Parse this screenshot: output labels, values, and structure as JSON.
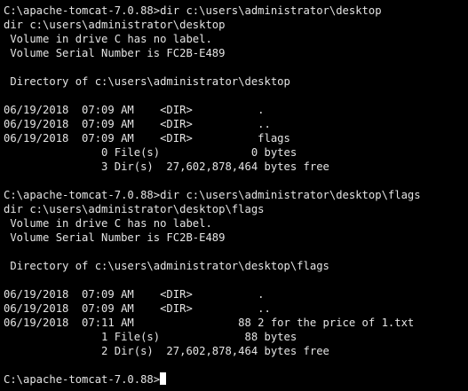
{
  "colors": {
    "background": "#000000",
    "foreground": "#e4e4e4",
    "cursor": "#ffffff"
  },
  "terminal": {
    "lines": [
      "C:\\apache-tomcat-7.0.88>dir c:\\users\\administrator\\desktop",
      "dir c:\\users\\administrator\\desktop",
      " Volume in drive C has no label.",
      " Volume Serial Number is FC2B-E489",
      "",
      " Directory of c:\\users\\administrator\\desktop",
      "",
      "06/19/2018  07:09 AM    <DIR>          .",
      "06/19/2018  07:09 AM    <DIR>          ..",
      "06/19/2018  07:09 AM    <DIR>          flags",
      "               0 File(s)              0 bytes",
      "               3 Dir(s)  27,602,878,464 bytes free",
      "",
      "C:\\apache-tomcat-7.0.88>dir c:\\users\\administrator\\desktop\\flags",
      "dir c:\\users\\administrator\\desktop\\flags",
      " Volume in drive C has no label.",
      " Volume Serial Number is FC2B-E489",
      "",
      " Directory of c:\\users\\administrator\\desktop\\flags",
      "",
      "06/19/2018  07:09 AM    <DIR>          .",
      "06/19/2018  07:09 AM    <DIR>          ..",
      "06/19/2018  07:11 AM                88 2 for the price of 1.txt",
      "               1 File(s)             88 bytes",
      "               2 Dir(s)  27,602,878,464 bytes free",
      ""
    ],
    "prompt": "C:\\apache-tomcat-7.0.88>"
  }
}
